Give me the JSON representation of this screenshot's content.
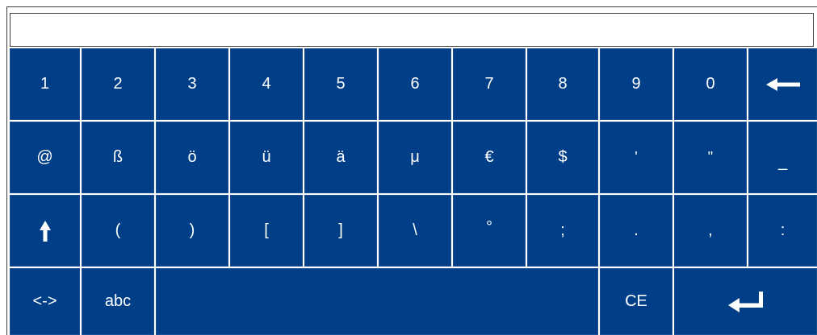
{
  "input": {
    "value": ""
  },
  "keyboard": {
    "row1": [
      "1",
      "2",
      "3",
      "4",
      "5",
      "6",
      "7",
      "8",
      "9",
      "0"
    ],
    "row2": [
      "@",
      "ß",
      "ö",
      "ü",
      "ä",
      "μ",
      "€",
      "$",
      "'",
      "\"",
      "_"
    ],
    "row3": [
      "(",
      ")",
      "[",
      "]",
      "\\",
      "°",
      ";",
      ".",
      ",",
      ":"
    ],
    "row4": {
      "switch_label": "<->",
      "abc_label": "abc",
      "clear_label": "CE"
    },
    "backspace_icon": "backspace-arrow-left-icon",
    "shift_icon": "shift-arrow-up-icon",
    "enter_icon": "enter-return-icon"
  },
  "colors": {
    "key_bg": "#003f87",
    "key_text": "#ffffff",
    "gap": "#ffffff"
  }
}
